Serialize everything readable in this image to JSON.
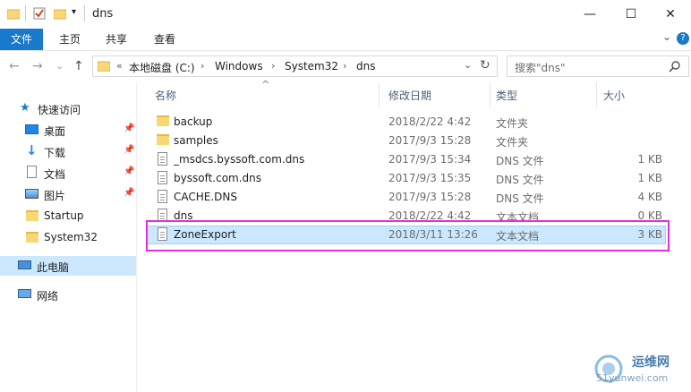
{
  "window": {
    "title": "dns",
    "minimize": "—",
    "maximize": "☐",
    "close": "✕"
  },
  "ribbon": {
    "tabs": [
      "文件",
      "主页",
      "共享",
      "查看"
    ],
    "expand": "⌄",
    "help": "?"
  },
  "address": {
    "back": "←",
    "forward": "→",
    "recent": "⌄",
    "up": "↑",
    "overflow": "«",
    "crumbs": [
      "本地磁盘 (C:)",
      "Windows",
      "System32",
      "dns"
    ],
    "dropdown": "⌄",
    "refresh": "↻"
  },
  "search": {
    "placeholder": "搜索\"dns\"",
    "icon": "🔍"
  },
  "nav": {
    "quick_access": "快速访问",
    "items": [
      {
        "label": "桌面",
        "pinned": true,
        "icon": "desktop-icon"
      },
      {
        "label": "下载",
        "pinned": true,
        "icon": "download-icon"
      },
      {
        "label": "文档",
        "pinned": true,
        "icon": "documents-icon"
      },
      {
        "label": "图片",
        "pinned": true,
        "icon": "pictures-icon"
      },
      {
        "label": "Startup",
        "pinned": false,
        "icon": "folder-icon"
      },
      {
        "label": "System32",
        "pinned": false,
        "icon": "folder-icon"
      }
    ],
    "this_pc": "此电脑",
    "network": "网络"
  },
  "columns": {
    "name": "名称",
    "modified": "修改日期",
    "type": "类型",
    "size": "大小",
    "sort_indicator": "^"
  },
  "files": [
    {
      "name": "backup",
      "modified": "2018/2/22 4:42",
      "type": "文件夹",
      "size": "",
      "kind": "folder"
    },
    {
      "name": "samples",
      "modified": "2017/9/3 15:28",
      "type": "文件夹",
      "size": "",
      "kind": "folder"
    },
    {
      "name": "_msdcs.byssoft.com.dns",
      "modified": "2017/9/3 15:34",
      "type": "DNS 文件",
      "size": "1 KB",
      "kind": "file"
    },
    {
      "name": "byssoft.com.dns",
      "modified": "2017/9/3 15:35",
      "type": "DNS 文件",
      "size": "1 KB",
      "kind": "file"
    },
    {
      "name": "CACHE.DNS",
      "modified": "2017/9/3 15:28",
      "type": "DNS 文件",
      "size": "4 KB",
      "kind": "file"
    },
    {
      "name": "dns",
      "modified": "2018/2/22 4:42",
      "type": "文本文档",
      "size": "0 KB",
      "kind": "file"
    },
    {
      "name": "ZoneExport",
      "modified": "2018/3/11 13:26",
      "type": "文本文档",
      "size": "3 KB",
      "kind": "file",
      "selected": true
    }
  ],
  "watermark": {
    "line1": "运维网",
    "line2": "51yunwei.com"
  },
  "colors": {
    "accent": "#1979ca",
    "selection": "#cce8ff",
    "highlight_box": "#e62ee0"
  }
}
